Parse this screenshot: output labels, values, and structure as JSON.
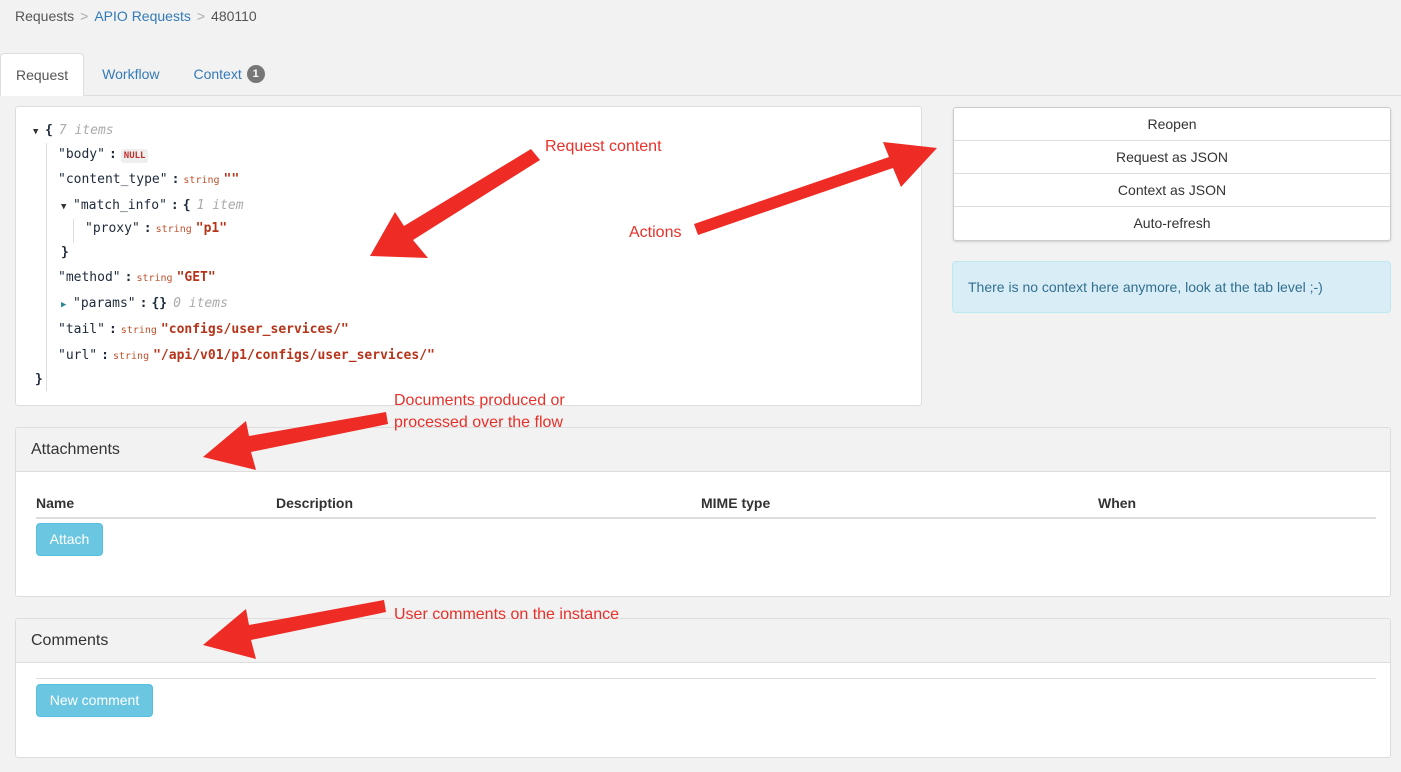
{
  "breadcrumb": {
    "items": [
      "Requests",
      "APIO Requests",
      "480110"
    ],
    "separator": ">"
  },
  "tabs": [
    {
      "label": "Request",
      "active": true
    },
    {
      "label": "Workflow",
      "active": false
    },
    {
      "label": "Context",
      "active": false,
      "badge": "1"
    }
  ],
  "json_view": {
    "root_meta": "7 items",
    "body_key": "\"body\"",
    "body_value": "NULL",
    "content_type_key": "\"content_type\"",
    "content_type_type": "string",
    "content_type_value": "\"\"",
    "match_info_key": "\"match_info\"",
    "match_info_meta": "1 item",
    "proxy_key": "\"proxy\"",
    "proxy_type": "string",
    "proxy_value": "\"p1\"",
    "method_key": "\"method\"",
    "method_type": "string",
    "method_value": "\"GET\"",
    "params_key": "\"params\"",
    "params_value": "{}",
    "params_meta": "0 items",
    "tail_key": "\"tail\"",
    "tail_type": "string",
    "tail_value": "\"configs/user_services/\"",
    "url_key": "\"url\"",
    "url_type": "string",
    "url_value": "\"/api/v01/p1/configs/user_services/\"",
    "open_brace": "{",
    "close_brace": "}",
    "colon": ":"
  },
  "actions": [
    "Reopen",
    "Request as JSON",
    "Context as JSON",
    "Auto-refresh"
  ],
  "info_alert": "There is no context here anymore, look at the tab level ;-)",
  "attachments": {
    "title": "Attachments",
    "columns": [
      "Name",
      "Description",
      "MIME type",
      "When"
    ],
    "attach_button": "Attach"
  },
  "comments": {
    "title": "Comments",
    "new_comment_button": "New comment"
  },
  "annotations": {
    "request_content": "Request content",
    "actions": "Actions",
    "documents_line1": "Documents produced or",
    "documents_line2": "processed over the flow",
    "comments": "User comments on the instance",
    "color": "#e8302a"
  }
}
